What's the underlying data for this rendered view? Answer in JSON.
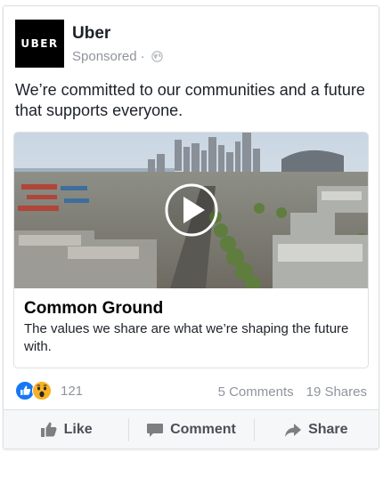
{
  "post": {
    "page_name": "Uber",
    "logo_text": "UBER",
    "sponsored_label": "Sponsored",
    "separator": "·",
    "privacy_icon": "globe-icon",
    "text": "We’re committed to our communities and a future that supports everyone."
  },
  "attachment": {
    "media_type": "video",
    "play_icon": "play-icon",
    "title": "Common Ground",
    "description": "The values we share are what we’re shaping the future with."
  },
  "engagement": {
    "reaction_icons": [
      "like-reaction-icon",
      "wow-reaction-icon"
    ],
    "reaction_count": "121",
    "comments": "5 Comments",
    "shares": "19 Shares"
  },
  "actions": {
    "like": "Like",
    "comment": "Comment",
    "share": "Share"
  },
  "colors": {
    "like_blue": "#1877f2",
    "wow_yellow": "#f7b125",
    "muted_text": "#90949c",
    "action_text": "#4b4f56",
    "border": "#dddfe2"
  }
}
